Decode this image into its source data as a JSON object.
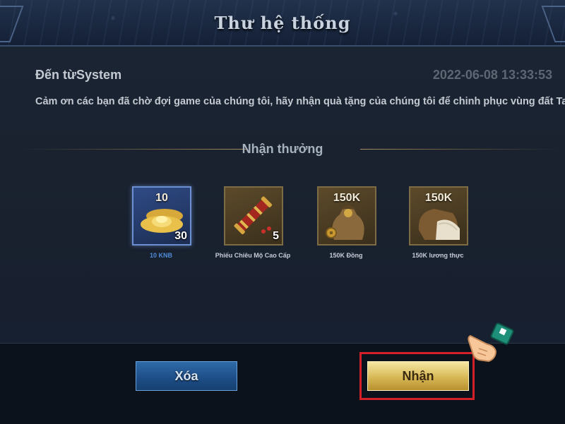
{
  "dialog": {
    "title": "Thư hệ thống",
    "sender": "Đến từSystem",
    "timestamp": "2022-06-08 13:33:53",
    "message": "Cảm ơn các bạn đã chờ đợi game của chúng tôi, hãy nhận quà tặng của chúng tôi để chinh phục vùng đất Tam Quốc này"
  },
  "rewards": {
    "title": "Nhận thưởng",
    "items": [
      {
        "name": "10 KNB",
        "top_value": "10",
        "count": "30",
        "icon": "gold-ingot-icon",
        "selected": true
      },
      {
        "name": "Phiếu Chiêu Mộ Cao Cấp",
        "top_value": "",
        "count": "5",
        "icon": "recruit-scroll-icon",
        "selected": false
      },
      {
        "name": "150K Đồng",
        "top_value": "150K",
        "count": "",
        "icon": "coin-bag-icon",
        "selected": false
      },
      {
        "name": "150K lương thực",
        "top_value": "150K",
        "count": "",
        "icon": "rice-sack-icon",
        "selected": false
      }
    ]
  },
  "buttons": {
    "delete": "Xóa",
    "receive": "Nhận"
  },
  "colors": {
    "panel": "#1b2433",
    "accent_gold": "#d8b856",
    "delete_blue": "#1d4d86",
    "highlight_red": "#d5202a"
  }
}
